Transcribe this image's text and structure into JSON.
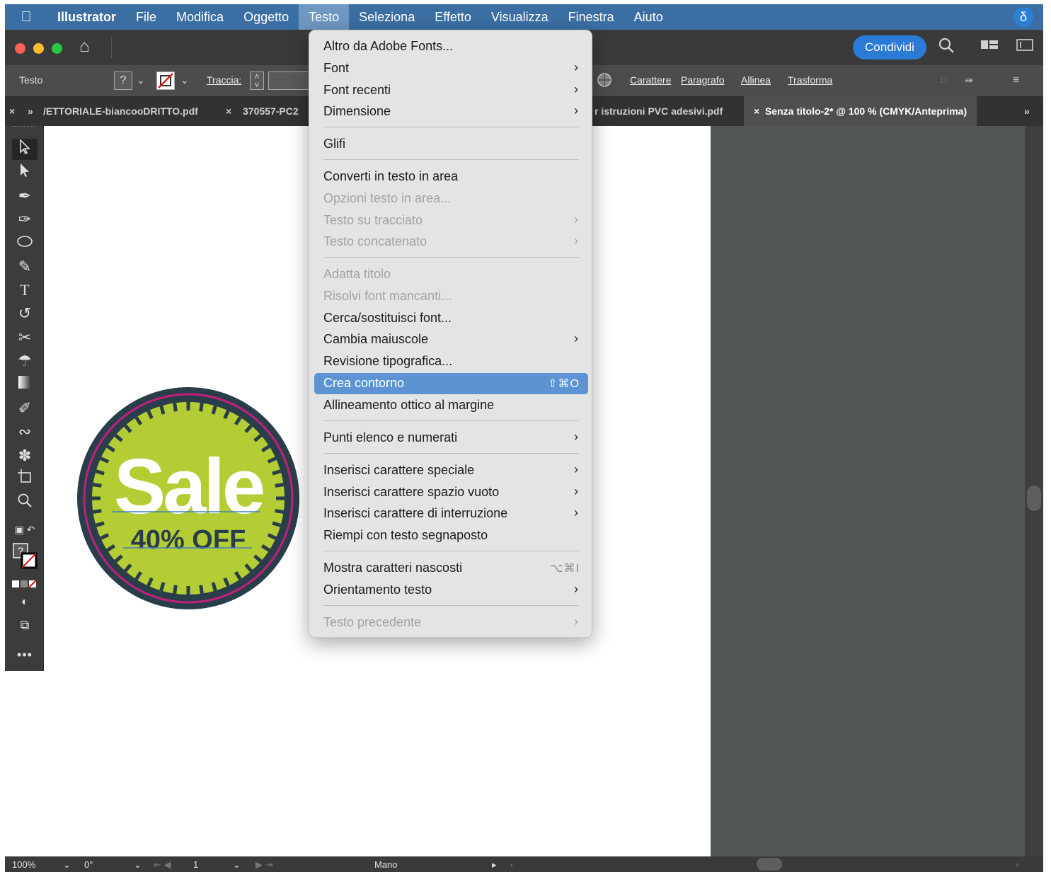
{
  "menubar": {
    "items": [
      "Illustrator",
      "File",
      "Modifica",
      "Oggetto",
      "Testo",
      "Seleziona",
      "Effetto",
      "Visualizza",
      "Finestra",
      "Aiuto"
    ],
    "active": "Testo",
    "siri_glyph": "δ"
  },
  "appbar": {
    "share_label": "Condividi"
  },
  "control": {
    "mode_label": "Testo",
    "fill_glyph": "?",
    "stroke_label": "Traccia:",
    "links": [
      "Carattere",
      "Paragrafo",
      "Allinea",
      "Trasforma"
    ]
  },
  "tabs": {
    "tab1": "/ETTORIALE-biancooDRITTO.pdf",
    "tab2": "370557-PC2",
    "tab3": "r istruzioni PVC adesivi.pdf",
    "active": "Senza titolo-2* @ 100 % (CMYK/Anteprima)",
    "close_glyph": "×",
    "more_glyph": "»"
  },
  "artwork": {
    "title": "Sale",
    "subtitle": "40% OFF",
    "colors": {
      "ring": "#2a3e4a",
      "fill": "#b5cd34",
      "accent": "#c0207d",
      "text": "#ffffff",
      "subtext": "#2a3e4a"
    }
  },
  "menu": {
    "items": [
      {
        "label": "Altro da Adobe Fonts...",
        "state": "enabled",
        "arrow": false,
        "shortcut": ""
      },
      {
        "label": "Font",
        "state": "enabled",
        "arrow": true,
        "shortcut": ""
      },
      {
        "label": "Font recenti",
        "state": "enabled",
        "arrow": true,
        "shortcut": ""
      },
      {
        "label": "Dimensione",
        "state": "enabled",
        "arrow": true,
        "shortcut": ""
      },
      {
        "label": "Glifi",
        "state": "enabled",
        "arrow": false,
        "shortcut": ""
      },
      {
        "label": "Converti in testo in area",
        "state": "enabled",
        "arrow": false,
        "shortcut": ""
      },
      {
        "label": "Opzioni testo in area...",
        "state": "disabled",
        "arrow": false,
        "shortcut": ""
      },
      {
        "label": "Testo su tracciato",
        "state": "disabled",
        "arrow": true,
        "shortcut": ""
      },
      {
        "label": "Testo concatenato",
        "state": "disabled",
        "arrow": true,
        "shortcut": ""
      },
      {
        "label": "Adatta titolo",
        "state": "disabled",
        "arrow": false,
        "shortcut": ""
      },
      {
        "label": "Risolvi font mancanti...",
        "state": "disabled",
        "arrow": false,
        "shortcut": ""
      },
      {
        "label": "Cerca/sostituisci font...",
        "state": "enabled",
        "arrow": false,
        "shortcut": ""
      },
      {
        "label": "Cambia maiuscole",
        "state": "enabled",
        "arrow": true,
        "shortcut": ""
      },
      {
        "label": "Revisione tipografica...",
        "state": "enabled",
        "arrow": false,
        "shortcut": ""
      },
      {
        "label": "Crea contorno",
        "state": "highlighted",
        "arrow": false,
        "shortcut": "⇧⌘O"
      },
      {
        "label": "Allineamento ottico al margine",
        "state": "enabled",
        "arrow": false,
        "shortcut": ""
      },
      {
        "label": "Punti elenco e numerati",
        "state": "enabled",
        "arrow": true,
        "shortcut": ""
      },
      {
        "label": "Inserisci carattere speciale",
        "state": "enabled",
        "arrow": true,
        "shortcut": ""
      },
      {
        "label": "Inserisci carattere spazio vuoto",
        "state": "enabled",
        "arrow": true,
        "shortcut": ""
      },
      {
        "label": "Inserisci carattere di interruzione",
        "state": "enabled",
        "arrow": true,
        "shortcut": ""
      },
      {
        "label": "Riempi con testo segnaposto",
        "state": "enabled",
        "arrow": false,
        "shortcut": ""
      },
      {
        "label": "Mostra caratteri nascosti",
        "state": "enabled",
        "arrow": false,
        "shortcut": "⌥⌘I"
      },
      {
        "label": "Orientamento testo",
        "state": "enabled",
        "arrow": true,
        "shortcut": ""
      },
      {
        "label": "Testo precedente",
        "state": "disabled",
        "arrow": true,
        "shortcut": ""
      }
    ]
  },
  "status": {
    "zoom": "100%",
    "rotation": "0°",
    "artboard": "1",
    "tool": "Mano"
  },
  "icons": {
    "tools": [
      "selection-tool-icon",
      "direct-selection-tool-icon",
      "pen-tool-icon",
      "curvature-tool-icon",
      "ellipse-tool-icon",
      "paintbrush-tool-icon",
      "type-tool-icon",
      "rotate-tool-icon",
      "scissors-tool-icon",
      "puppet-warp-tool-icon",
      "gradient-tool-icon",
      "eyedropper-tool-icon",
      "blend-tool-icon",
      "symbol-sprayer-tool-icon",
      "artboard-tool-icon",
      "zoom-tool-icon"
    ]
  }
}
